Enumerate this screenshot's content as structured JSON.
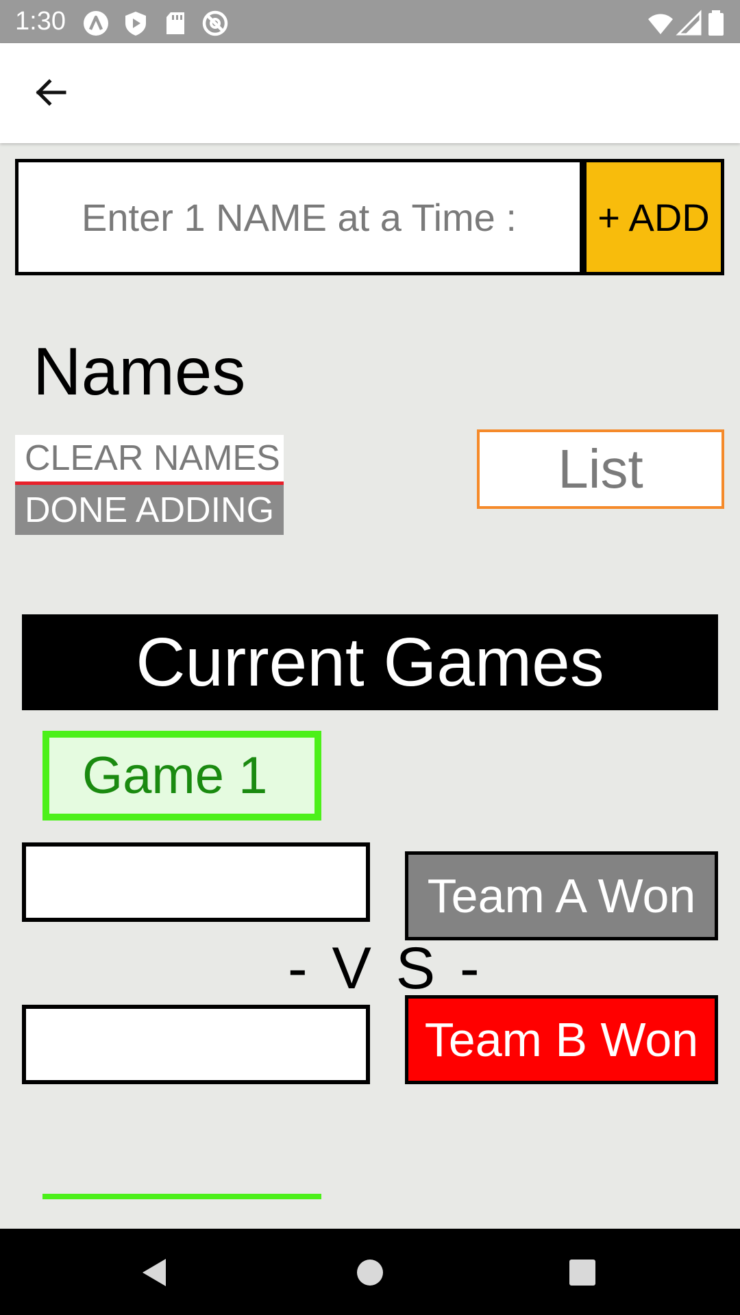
{
  "status_bar": {
    "time": "1:30",
    "left_icons": [
      "a-logo-icon",
      "shield-play-icon",
      "sd-card-icon",
      "at-sign-icon"
    ],
    "right_icons": [
      "wifi-icon",
      "signal-icon",
      "battery-icon"
    ]
  },
  "app_bar": {
    "back_icon": "arrow-back-icon"
  },
  "name_entry": {
    "placeholder": "Enter 1 NAME at a Time :",
    "value": "",
    "add_label": "+ ADD"
  },
  "names_section": {
    "title": "Names",
    "clear_label": "CLEAR NAMES",
    "done_label": "DONE ADDING",
    "list_label": "List"
  },
  "games": {
    "header": "Current Games",
    "game_label": "Game 1",
    "team_a_value": "",
    "team_b_value": "",
    "vs_label": "- V S -",
    "team_a_won_label": "Team A Won",
    "team_b_won_label": "Team B Won"
  },
  "colors": {
    "add_button": "#f8bc0c",
    "list_border": "#f58a2a",
    "game_border": "#4cf01a",
    "game_text": "#1a8a10",
    "team_b_won": "#ff0000",
    "team_a_won": "#838383",
    "clear_underline": "#e8202a"
  },
  "nav_bar": {
    "icons": [
      "back-triangle-icon",
      "home-circle-icon",
      "recents-square-icon"
    ]
  }
}
